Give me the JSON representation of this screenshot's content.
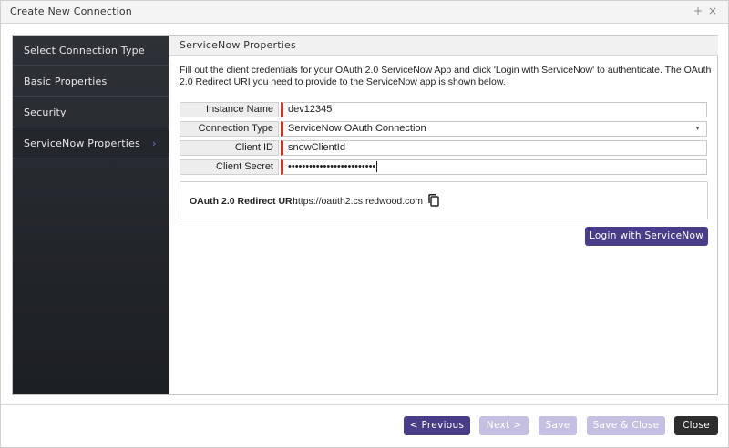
{
  "window": {
    "title": "Create New Connection",
    "add_icon": "+",
    "close_icon": "×"
  },
  "nav": {
    "items": [
      {
        "label": "Select Connection Type"
      },
      {
        "label": "Basic Properties"
      },
      {
        "label": "Security"
      },
      {
        "label": "ServiceNow Properties",
        "active": true
      }
    ],
    "active_chevron": "›"
  },
  "main": {
    "header": "ServiceNow Properties",
    "description": "Fill out the client credentials for your OAuth 2.0 ServiceNow App and click 'Login with ServiceNow' to authenticate. The OAuth 2.0 Redirect URI you need to provide to the ServiceNow app is shown below.",
    "fields": {
      "instance_name": {
        "label": "Instance Name",
        "value": "dev12345"
      },
      "connection_type": {
        "label": "Connection Type",
        "value": "ServiceNow OAuth Connection"
      },
      "client_id": {
        "label": "Client ID",
        "value": "snowClientId"
      },
      "client_secret": {
        "label": "Client Secret",
        "value": "•••••••••••••••••••••••••"
      }
    },
    "redirect": {
      "label": "OAuth 2.0 Redirect URI:",
      "value": "https://oauth2.cs.redwood.com"
    },
    "login_button": "Login with ServiceNow"
  },
  "footer": {
    "previous": "< Previous",
    "next": "Next >",
    "save": "Save",
    "save_close": "Save & Close",
    "close": "Close"
  },
  "colors": {
    "primary": "#4a3d87",
    "primary_disabled": "#c5bfe2",
    "required_marker": "#c0392b",
    "nav_background": "#22252a"
  },
  "icons": {
    "copy": "copy-icon",
    "chevron": "chevron-right-icon",
    "caret": "caret-down-icon"
  }
}
